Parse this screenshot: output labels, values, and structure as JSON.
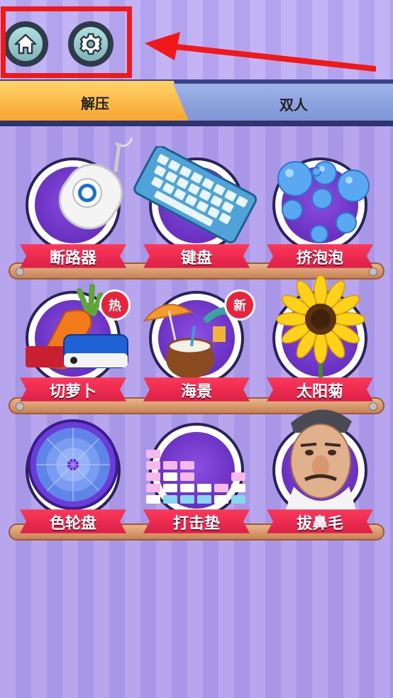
{
  "header": {
    "home_icon": "home-icon",
    "settings_icon": "gear-icon",
    "annotation_color": "#f01818"
  },
  "tabs": [
    {
      "label": "解压",
      "active": true
    },
    {
      "label": "双人",
      "active": false
    }
  ],
  "games": [
    {
      "label": "断路器",
      "art": "circuit-breaker-icon"
    },
    {
      "label": "键盘",
      "art": "keyboard-icon"
    },
    {
      "label": "挤泡泡",
      "art": "bubbles-icon"
    },
    {
      "label": "切萝卜",
      "art": "carrot-icon",
      "badge": "热"
    },
    {
      "label": "海景",
      "art": "coconut-beach-icon",
      "badge": "新"
    },
    {
      "label": "太阳菊",
      "art": "sunflower-icon"
    },
    {
      "label": "色轮盘",
      "art": "color-wheel-icon"
    },
    {
      "label": "打击垫",
      "art": "drum-pad-icon"
    },
    {
      "label": "拔鼻毛",
      "art": "face-icon"
    }
  ]
}
